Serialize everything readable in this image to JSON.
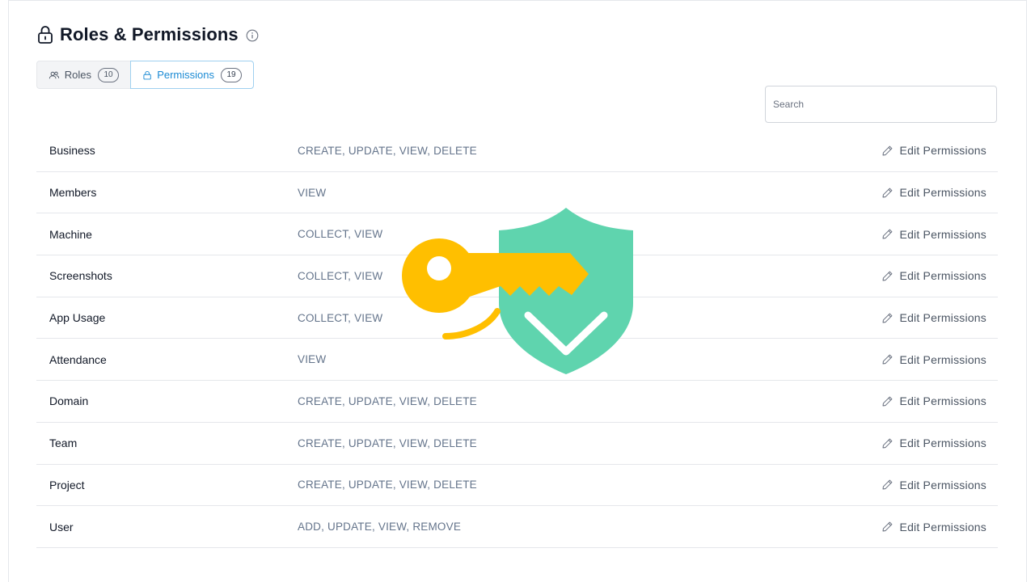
{
  "header": {
    "title": "Roles & Permissions",
    "title_icon": "lock-icon",
    "info_icon": "info-icon"
  },
  "tabs": [
    {
      "label": "Roles",
      "count": "10",
      "icon": "users-icon",
      "active": false
    },
    {
      "label": "Permissions",
      "count": "19",
      "icon": "lock-icon",
      "active": true
    }
  ],
  "search": {
    "placeholder": "Search",
    "value": ""
  },
  "permissions": [
    {
      "name": "Business",
      "actions": "CREATE, UPDATE, VIEW,  DELETE",
      "edit_label": "Edit Permissions"
    },
    {
      "name": "Members",
      "actions": "VIEW",
      "edit_label": "Edit Permissions"
    },
    {
      "name": "Machine",
      "actions": "COLLECT, VIEW",
      "edit_label": "Edit Permissions"
    },
    {
      "name": "Screenshots",
      "actions": "COLLECT, VIEW",
      "edit_label": "Edit Permissions"
    },
    {
      "name": "App Usage",
      "actions": "COLLECT, VIEW",
      "edit_label": "Edit Permissions"
    },
    {
      "name": "Attendance",
      "actions": "VIEW",
      "edit_label": "Edit Permissions"
    },
    {
      "name": "Domain",
      "actions": "CREATE, UPDATE, VIEW,  DELETE",
      "edit_label": "Edit Permissions"
    },
    {
      "name": "Team",
      "actions": "CREATE, UPDATE, VIEW,  DELETE",
      "edit_label": "Edit Permissions"
    },
    {
      "name": "Project",
      "actions": "CREATE, UPDATE, VIEW,  DELETE",
      "edit_label": "Edit Permissions"
    },
    {
      "name": "User",
      "actions": "ADD, UPDATE, VIEW,  REMOVE",
      "edit_label": "Edit Permissions"
    }
  ],
  "colors": {
    "accent": "#1a8ad4",
    "key": "#ffbf00",
    "shield": "#5fd4ae"
  },
  "illustration": {
    "icons": [
      "key-icon",
      "shield-check-icon"
    ]
  }
}
